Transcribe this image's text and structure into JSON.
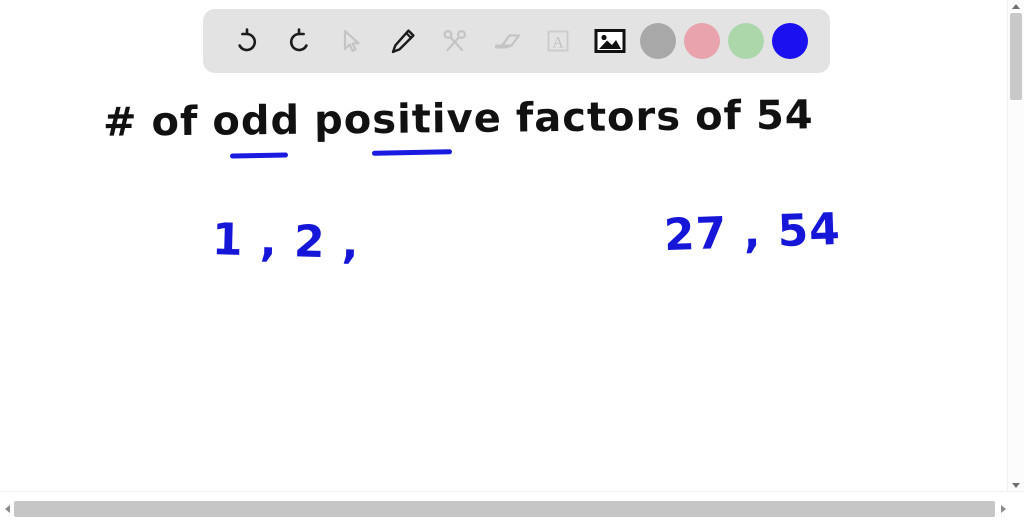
{
  "toolbar": {
    "tools": [
      {
        "name": "undo-icon",
        "label": "Undo",
        "state": "enabled"
      },
      {
        "name": "redo-icon",
        "label": "Redo",
        "state": "enabled"
      },
      {
        "name": "cursor-icon",
        "label": "Select",
        "state": "disabled"
      },
      {
        "name": "pen-icon",
        "label": "Pen",
        "state": "enabled"
      },
      {
        "name": "scissors-icon",
        "label": "Cut",
        "state": "disabled"
      },
      {
        "name": "eraser-icon",
        "label": "Eraser",
        "state": "disabled"
      },
      {
        "name": "text-icon",
        "label": "Text",
        "state": "disabled"
      },
      {
        "name": "image-icon",
        "label": "Image",
        "state": "active"
      }
    ],
    "swatches": [
      {
        "name": "color-swatch-gray",
        "label": "Gray",
        "color": "#a8a8a8",
        "selected": false
      },
      {
        "name": "color-swatch-red",
        "label": "Red",
        "color": "#e8a3ac",
        "selected": false
      },
      {
        "name": "color-swatch-green",
        "label": "Green",
        "color": "#abd7ab",
        "selected": false
      },
      {
        "name": "color-swatch-blue",
        "label": "Blue",
        "color": "#1a10f0",
        "selected": true
      }
    ],
    "background_color": "#e3e3e3"
  },
  "whiteboard": {
    "title": {
      "words": [
        "#",
        "of",
        "odd",
        "positive",
        "factors",
        "of",
        "54"
      ],
      "full_text": "# of odd positive factors of 54",
      "ink_color": "#111111",
      "underline_color": "#1a1ae0"
    },
    "answers": {
      "left": "1 , 2 ,",
      "right": "27 , 54",
      "ink_color": "#1616d8"
    }
  },
  "scrollbars": {
    "vertical": {
      "up_arrow": "▲",
      "down_arrow": "▼",
      "thumb_color": "#c9c9c9"
    },
    "horizontal": {
      "left_arrow": "◀",
      "right_arrow": "▶",
      "thumb_color": "#c6c6c6"
    }
  }
}
